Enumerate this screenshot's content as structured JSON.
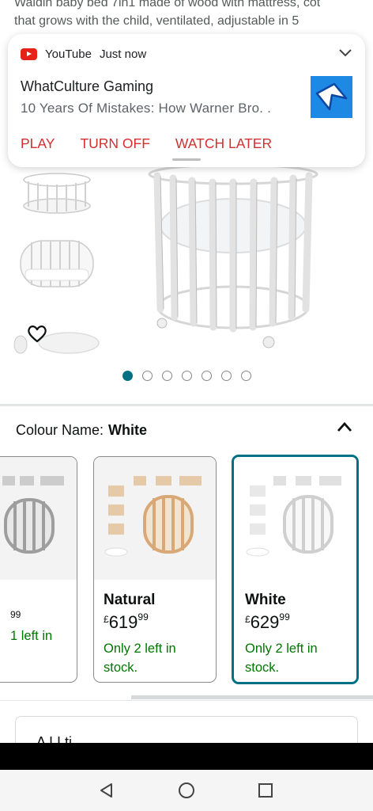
{
  "product": {
    "description_line1": "Waldin baby bed 7in1 made of wood with mattress, cot",
    "description_line2": "that grows with the child, ventilated, adjustable in 5"
  },
  "notification": {
    "app_name": "YouTube",
    "time": "Just now",
    "title": "WhatCulture Gaming",
    "text": "10 Years Of Mistakes: How Warner Bro. .",
    "actions": [
      "PLAY",
      "TURN OFF",
      "WATCH LATER"
    ]
  },
  "gallery": {
    "dot_count": 7,
    "active_index": 0
  },
  "colour": {
    "label": "Colour Name:",
    "selected": "White"
  },
  "swatches": [
    {
      "name": "",
      "price_main": "99",
      "price_cur": "",
      "price_frac": "",
      "stock": "1 left in",
      "stock2": ""
    },
    {
      "name": "Natural",
      "price_cur": "£",
      "price_main": "619",
      "price_frac": "99",
      "stock": "Only 2 left in",
      "stock2": "stock."
    },
    {
      "name": "White",
      "price_cur": "£",
      "price_main": "629",
      "price_frac": "99",
      "stock": "Only 2 left in",
      "stock2": "stock."
    }
  ],
  "next_section": {
    "label": "A       I I     ti"
  },
  "colors": {
    "accent": "#007185",
    "stock_green": "#007600",
    "notif_action": "#d32f2f",
    "youtube_red": "#e62117"
  }
}
